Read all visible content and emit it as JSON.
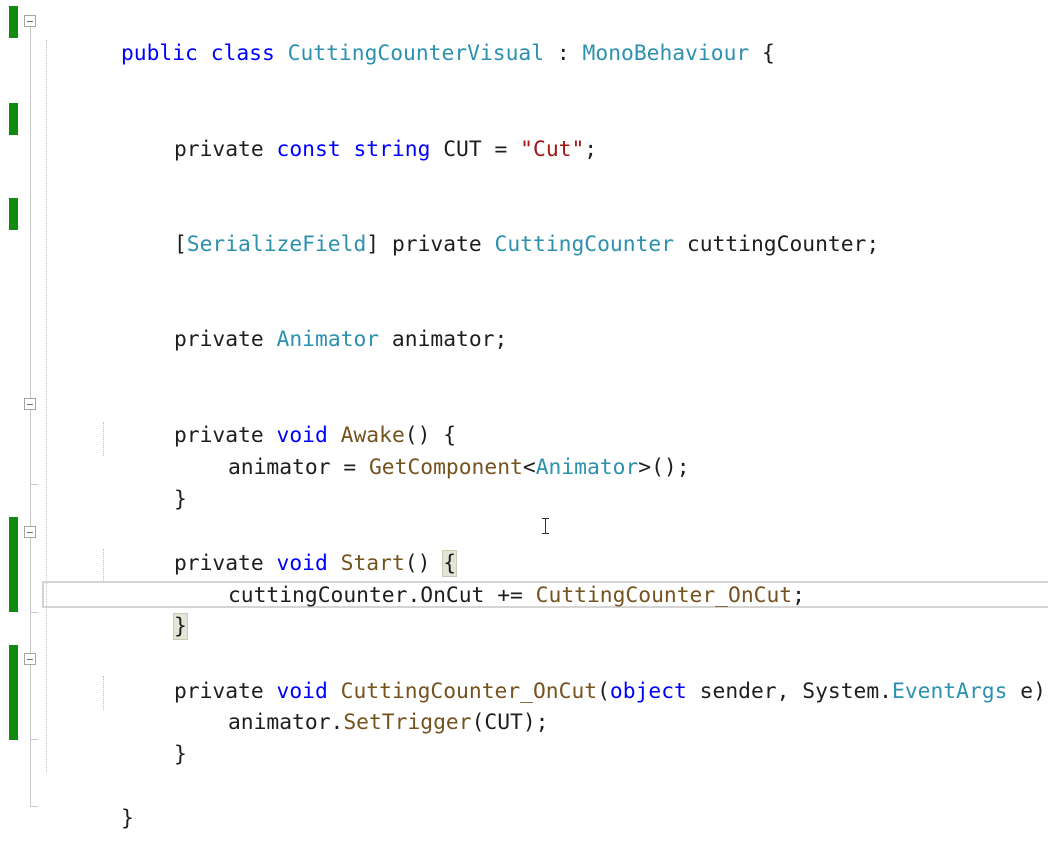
{
  "editor": {
    "language": "C#",
    "lines": {
      "class_decl": {
        "kw_public": "public",
        "kw_class": "class",
        "class_name": "CuttingCounterVisual",
        "colon": " : ",
        "base_class": "MonoBehaviour",
        "open_brace": " {"
      },
      "const_decl": {
        "kw_private": "private",
        "kw_const": "const",
        "kw_string": "string",
        "name": " CUT = ",
        "value": "\"Cut\"",
        "end": ";"
      },
      "serialize_decl": {
        "open_bracket": "[",
        "attribute": "SerializeField",
        "close_bracket": "] ",
        "kw_private": "private",
        "type": "CuttingCounter",
        "name": " cuttingCounter;"
      },
      "animator_decl": {
        "kw_private": "private",
        "type": "Animator",
        "name": " animator;"
      },
      "awake_sig": {
        "kw_private": "private",
        "kw_void": "void",
        "method": "Awake",
        "rest": "() {"
      },
      "awake_body": {
        "target": "animator = ",
        "method": "GetComponent",
        "lt": "<",
        "type": "Animator",
        "rest": ">();"
      },
      "awake_close": "}",
      "start_sig": {
        "kw_private": "private",
        "kw_void": "void",
        "method": "Start",
        "parens": "() ",
        "open_brace": "{"
      },
      "start_body": {
        "target": "cuttingCounter.OnCut += ",
        "handler": "CuttingCounter_OnCut",
        "end": ";"
      },
      "start_close": "}",
      "oncut_sig": {
        "kw_private": "private",
        "kw_void": "void",
        "method": "CuttingCounter_OnCut",
        "open_paren": "(",
        "kw_object": "object",
        "param1": " sender, System.",
        "param_type": "EventArgs",
        "rest": " e) {"
      },
      "oncut_body": {
        "target": "animator.",
        "method": "SetTrigger",
        "rest": "(CUT);"
      },
      "oncut_close": "}",
      "class_close": "}"
    },
    "colors": {
      "keyword": "#0000ff",
      "type": "#2b91af",
      "method": "#74531f",
      "string": "#a31515",
      "plain": "#1e1e1e",
      "change_bar": "#108b10"
    }
  }
}
